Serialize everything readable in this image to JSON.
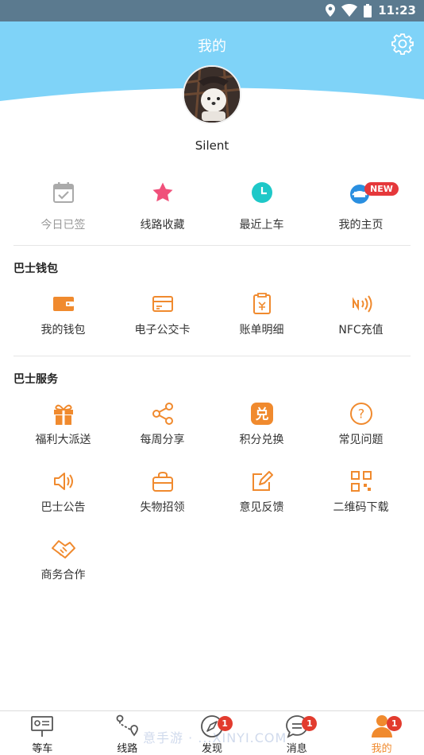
{
  "status_bar": {
    "time": "11:23"
  },
  "header": {
    "title": "我的"
  },
  "profile": {
    "username": "Silent"
  },
  "quick_actions": [
    {
      "label": "今日已签",
      "icon": "calendar-check-icon",
      "muted": true
    },
    {
      "label": "线路收藏",
      "icon": "star-icon"
    },
    {
      "label": "最近上车",
      "icon": "clock-icon"
    },
    {
      "label": "我的主页",
      "icon": "homepage-icon",
      "badge": "NEW"
    }
  ],
  "wallet": {
    "title": "巴士钱包",
    "items": [
      {
        "label": "我的钱包",
        "icon": "wallet-icon"
      },
      {
        "label": "电子公交卡",
        "icon": "card-icon"
      },
      {
        "label": "账单明细",
        "icon": "bill-icon"
      },
      {
        "label": "NFC充值",
        "icon": "nfc-icon"
      }
    ]
  },
  "services": {
    "title": "巴士服务",
    "items": [
      {
        "label": "福利大派送",
        "icon": "gift-icon"
      },
      {
        "label": "每周分享",
        "icon": "share-icon"
      },
      {
        "label": "积分兑换",
        "icon": "redeem-icon",
        "glyph": "兑"
      },
      {
        "label": "常见问题",
        "icon": "question-icon",
        "glyph": "?"
      },
      {
        "label": "巴士公告",
        "icon": "speaker-icon"
      },
      {
        "label": "失物招领",
        "icon": "bag-icon"
      },
      {
        "label": "意见反馈",
        "icon": "edit-icon"
      },
      {
        "label": "二维码下载",
        "icon": "qrcode-icon"
      },
      {
        "label": "商务合作",
        "icon": "handshake-icon"
      }
    ]
  },
  "tabbar": [
    {
      "label": "等车",
      "icon": "bus-stop-icon"
    },
    {
      "label": "线路",
      "icon": "route-icon"
    },
    {
      "label": "发现",
      "icon": "compass-icon",
      "badge": "1"
    },
    {
      "label": "消息",
      "icon": "message-icon",
      "badge": "1"
    },
    {
      "label": "我的",
      "icon": "person-icon",
      "badge": "1",
      "active": true
    }
  ],
  "watermark": "意手游 · ...XINYI.COM",
  "colors": {
    "header_blue": "#7fd3f8",
    "accent_orange": "#f08a2e",
    "badge_red": "#e23b2e",
    "star_pink": "#f0507a",
    "clock_teal": "#1ec8c8"
  }
}
